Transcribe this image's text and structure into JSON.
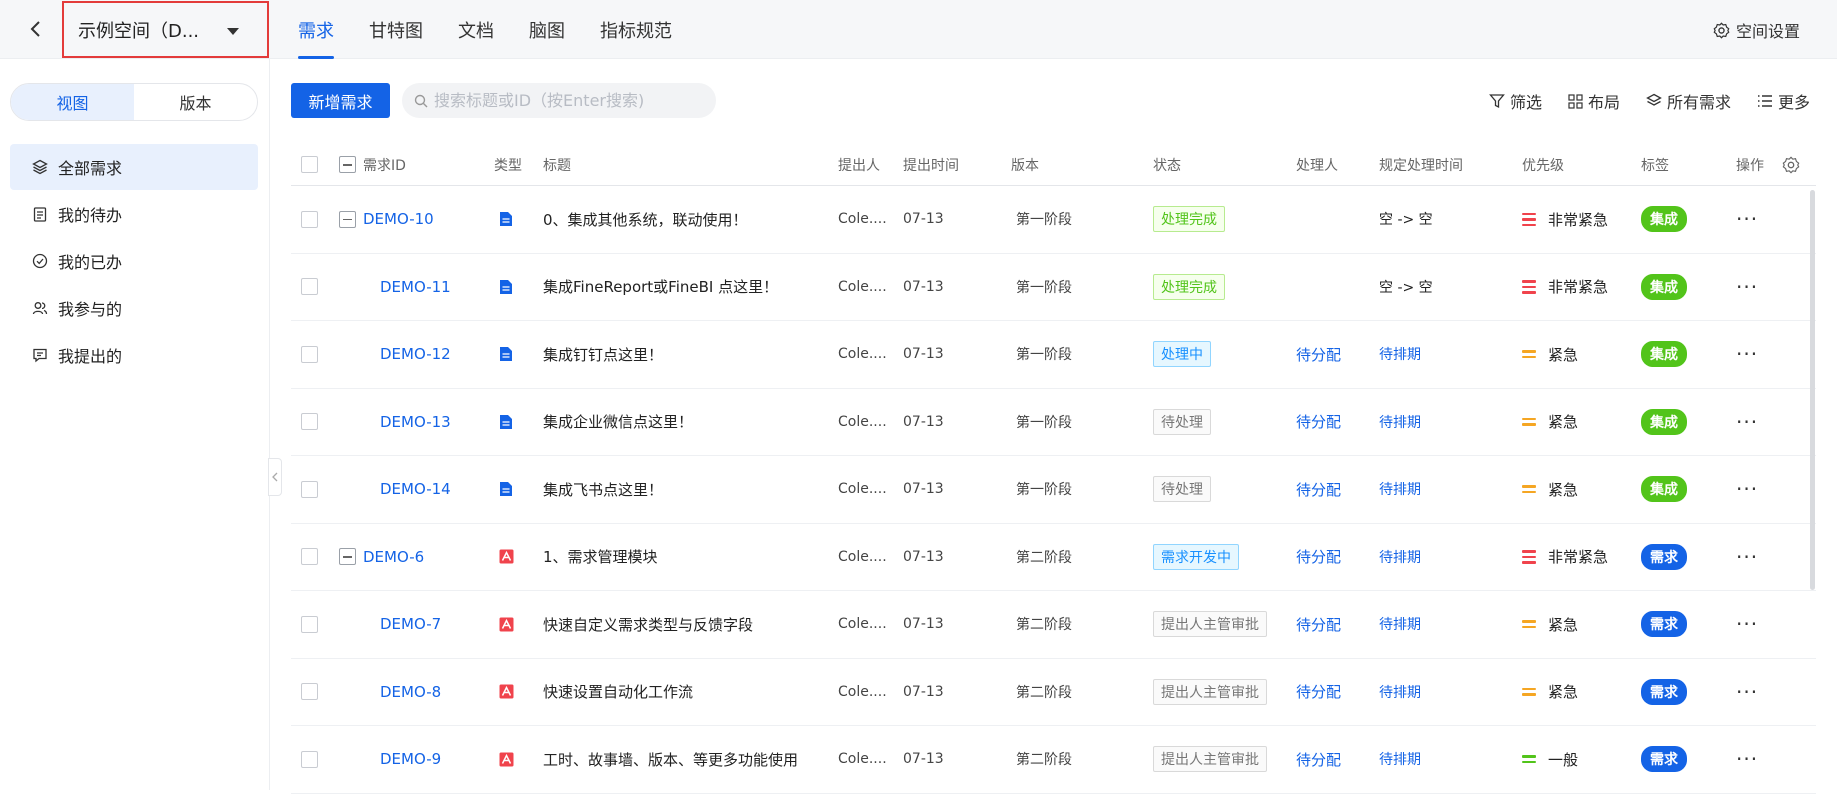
{
  "header": {
    "space_name": "示例空间（D...",
    "tabs": [
      "需求",
      "甘特图",
      "文档",
      "脑图",
      "指标规范"
    ],
    "settings_label": "空间设置"
  },
  "sidebar": {
    "segments": [
      "视图",
      "版本"
    ],
    "items": [
      "全部需求",
      "我的待办",
      "我的已办",
      "我参与的",
      "我提出的"
    ]
  },
  "toolbar": {
    "new_label": "新增需求",
    "search_placeholder": "搜索标题或ID（按Enter搜索)",
    "filter_label": "筛选",
    "layout_label": "布局",
    "all_label": "所有需求",
    "more_label": "更多"
  },
  "table": {
    "columns": {
      "id": "需求ID",
      "type": "类型",
      "title": "标题",
      "proposer": "提出人",
      "time": "提出时间",
      "version": "版本",
      "status": "状态",
      "handler": "处理人",
      "deadline": "规定处理时间",
      "priority": "优先级",
      "tag": "标签",
      "action": "操作"
    },
    "rows": [
      {
        "id": "DEMO-10",
        "title": "0、集成其他系统，联动使用！",
        "proposer": "Cole....",
        "time": "07-13",
        "version": "第一阶段",
        "status": "处理完成",
        "handler": "",
        "deadline": "空 -> 空",
        "priority": "非常紧急",
        "tag": "集成"
      },
      {
        "id": "DEMO-11",
        "title": "集成FineReport或FineBI 点这里！",
        "proposer": "Cole....",
        "time": "07-13",
        "version": "第一阶段",
        "status": "处理完成",
        "handler": "",
        "deadline": "空 -> 空",
        "priority": "非常紧急",
        "tag": "集成"
      },
      {
        "id": "DEMO-12",
        "title": "集成钉钉点这里！",
        "proposer": "Cole....",
        "time": "07-13",
        "version": "第一阶段",
        "status": "处理中",
        "handler": "待分配",
        "deadline": "待排期",
        "priority": "紧急",
        "tag": "集成"
      },
      {
        "id": "DEMO-13",
        "title": "集成企业微信点这里！",
        "proposer": "Cole....",
        "time": "07-13",
        "version": "第一阶段",
        "status": "待处理",
        "handler": "待分配",
        "deadline": "待排期",
        "priority": "紧急",
        "tag": "集成"
      },
      {
        "id": "DEMO-14",
        "title": "集成飞书点这里！",
        "proposer": "Cole....",
        "time": "07-13",
        "version": "第一阶段",
        "status": "待处理",
        "handler": "待分配",
        "deadline": "待排期",
        "priority": "紧急",
        "tag": "集成"
      },
      {
        "id": "DEMO-6",
        "title": "1、需求管理模块",
        "proposer": "Cole....",
        "time": "07-13",
        "version": "第二阶段",
        "status": "需求开发中",
        "handler": "待分配",
        "deadline": "待排期",
        "priority": "非常紧急",
        "tag": "需求"
      },
      {
        "id": "DEMO-7",
        "title": "快速自定义需求类型与反馈字段",
        "proposer": "Cole....",
        "time": "07-13",
        "version": "第二阶段",
        "status": "提出人主管审批",
        "handler": "待分配",
        "deadline": "待排期",
        "priority": "紧急",
        "tag": "需求"
      },
      {
        "id": "DEMO-8",
        "title": "快速设置自动化工作流",
        "proposer": "Cole....",
        "time": "07-13",
        "version": "第二阶段",
        "status": "提出人主管审批",
        "handler": "待分配",
        "deadline": "待排期",
        "priority": "紧急",
        "tag": "需求"
      },
      {
        "id": "DEMO-9",
        "title": "工时、故事墙、版本、等更多功能使用",
        "proposer": "Cole....",
        "time": "07-13",
        "version": "第二阶段",
        "status": "提出人主管审批",
        "handler": "待分配",
        "deadline": "待排期",
        "priority": "一般",
        "tag": "需求"
      }
    ],
    "more_symbol": "···"
  },
  "colors": {
    "accent": "#1463e6",
    "prio_very_urgent": "#f0434c",
    "prio_urgent": "#f5a623",
    "prio_normal": "#52c41a",
    "tag_integration": "#52c41a",
    "tag_requirement": "#1463e6",
    "doc_icon": "#1463e6",
    "req_icon": "#f0434c"
  }
}
